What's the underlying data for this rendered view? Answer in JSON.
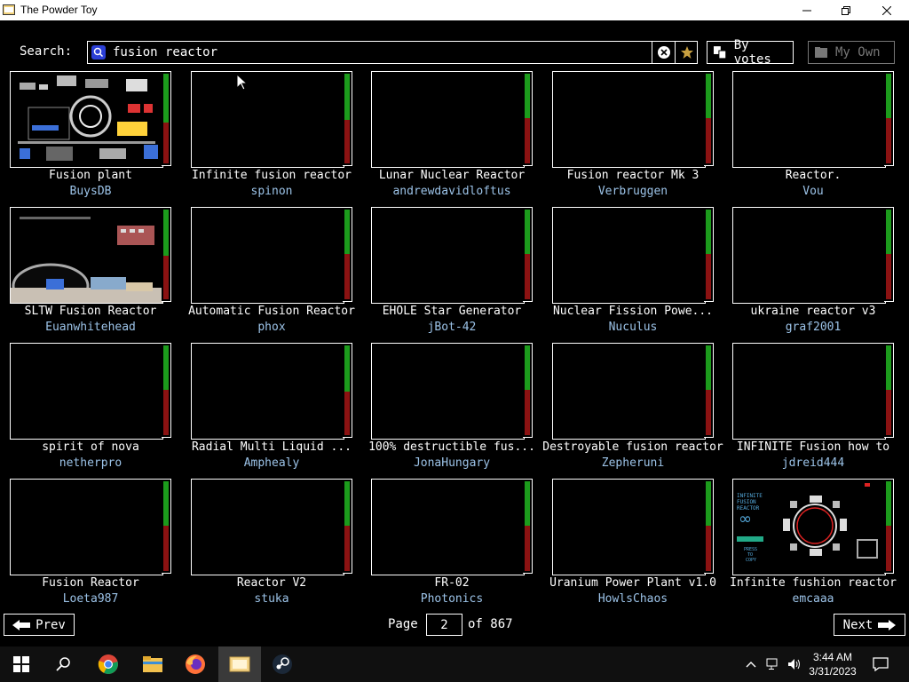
{
  "window": {
    "title": "The Powder Toy"
  },
  "search": {
    "label": "Search:",
    "value": "fusion reactor",
    "sort_label": "By votes",
    "own_label": "My Own"
  },
  "saves": [
    {
      "title": "Fusion plant",
      "author": "BuysDB",
      "up": 0.55,
      "down": 0.45,
      "thumb": "fusion-plant"
    },
    {
      "title": "Infinite fusion reactor",
      "author": "spinon",
      "up": 0.52,
      "down": 0.48,
      "thumb": ""
    },
    {
      "title": "Lunar Nuclear Reactor",
      "author": "andrewdavidloftus",
      "up": 0.5,
      "down": 0.5,
      "thumb": ""
    },
    {
      "title": "Fusion reactor Mk 3",
      "author": "Verbruggen",
      "up": 0.5,
      "down": 0.5,
      "thumb": ""
    },
    {
      "title": "Reactor.",
      "author": "Vou",
      "up": 0.5,
      "down": 0.5,
      "thumb": ""
    },
    {
      "title": "SLTW Fusion Reactor",
      "author": "Euanwhitehead",
      "up": 0.52,
      "down": 0.48,
      "thumb": "sltw"
    },
    {
      "title": "Automatic Fusion Reactor",
      "author": "phox",
      "up": 0.5,
      "down": 0.5,
      "thumb": ""
    },
    {
      "title": "EHOLE Star Generator",
      "author": "jBot-42",
      "up": 0.5,
      "down": 0.5,
      "thumb": ""
    },
    {
      "title": "Nuclear Fission Powe...",
      "author": "Nuculus",
      "up": 0.5,
      "down": 0.5,
      "thumb": ""
    },
    {
      "title": "ukraine reactor v3",
      "author": "graf2001",
      "up": 0.5,
      "down": 0.5,
      "thumb": ""
    },
    {
      "title": "spirit of nova",
      "author": "netherpro",
      "up": 0.5,
      "down": 0.5,
      "thumb": ""
    },
    {
      "title": "Radial Multi Liquid ...",
      "author": "Amphealy",
      "up": 0.52,
      "down": 0.48,
      "thumb": ""
    },
    {
      "title": "100% destructible fus...",
      "author": "JonaHungary",
      "up": 0.5,
      "down": 0.5,
      "thumb": ""
    },
    {
      "title": "Destroyable fusion reactor",
      "author": "Zepheruni",
      "up": 0.5,
      "down": 0.5,
      "thumb": ""
    },
    {
      "title": "INFINITE Fusion how to",
      "author": "jdreid444",
      "up": 0.5,
      "down": 0.5,
      "thumb": ""
    },
    {
      "title": "Fusion Reactor",
      "author": "Loeta987",
      "up": 0.5,
      "down": 0.5,
      "thumb": ""
    },
    {
      "title": "Reactor V2",
      "author": "stuka",
      "up": 0.5,
      "down": 0.5,
      "thumb": ""
    },
    {
      "title": "FR-02",
      "author": "Photonics",
      "up": 0.5,
      "down": 0.5,
      "thumb": ""
    },
    {
      "title": "Uranium Power Plant v1.0",
      "author": "HowlsChaos",
      "up": 0.5,
      "down": 0.5,
      "thumb": ""
    },
    {
      "title": "Infinite fushion reactor",
      "author": "emcaaa",
      "up": 0.5,
      "down": 0.5,
      "thumb": "infinite-fushion"
    }
  ],
  "pagination": {
    "prev_label": "Prev",
    "next_label": "Next",
    "page_label": "Page",
    "page": "2",
    "of_label": "of 867"
  },
  "thumb_text": {
    "top_lines": [
      "INFINITE",
      "FUSION",
      "REACTOR"
    ],
    "infinity": "∞",
    "bottom_lines": [
      "PRESS",
      "TO",
      "COPY"
    ]
  },
  "taskbar": {
    "time": "3:44 AM",
    "date": "3/31/2023"
  },
  "colors": {
    "vote_up": "#1c9b1c",
    "vote_down": "#8b1212",
    "author": "#9cc3e8",
    "search_icon": "#2b3fd6"
  }
}
